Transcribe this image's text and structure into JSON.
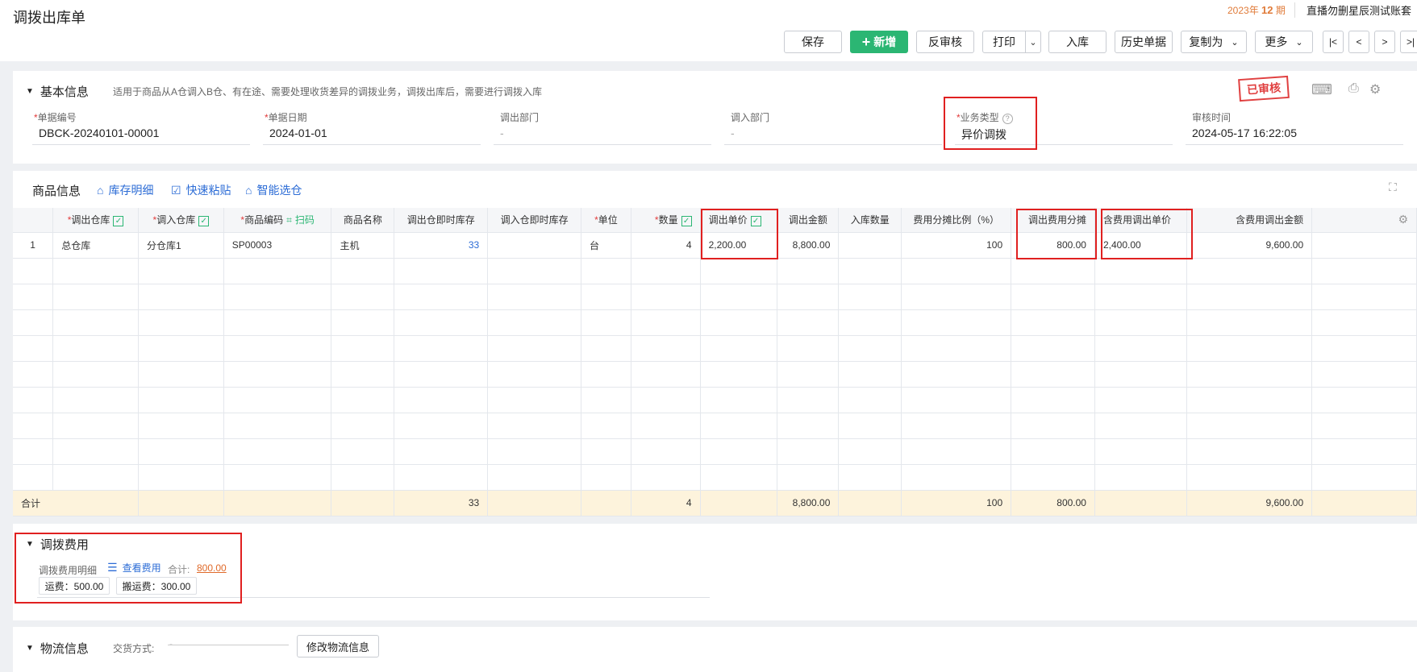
{
  "page": {
    "title": "调拨出库单"
  },
  "period": {
    "year": "2023年",
    "num": "12",
    "suffix": "期"
  },
  "account": {
    "name": "直播勿删星辰测试账套"
  },
  "toolbar": {
    "save": "保存",
    "add": "新增",
    "unaudit": "反审核",
    "print": "打印",
    "stock_in": "入库",
    "history": "历史单据",
    "copy_as": "复制为",
    "more": "更多"
  },
  "nav": {
    "first": "|<",
    "prev": "<",
    "next": ">",
    "last": ">|"
  },
  "basic": {
    "title": "基本信息",
    "desc": "适用于商品从A仓调入B仓、有在途、需要处理收货差异的调拨业务，调拨出库后，需要进行调拨入库",
    "stamp": "已审核",
    "fields": [
      {
        "label": "单据编号",
        "value": "DBCK-20240101-00001"
      },
      {
        "label": "单据日期",
        "value": "2024-01-01"
      },
      {
        "label": "调出部门",
        "value": "-"
      },
      {
        "label": "调入部门",
        "value": "-"
      },
      {
        "label": "业务类型",
        "value": "异价调拨"
      },
      {
        "label": "审核时间",
        "value": "2024-05-17 16:22:05"
      }
    ]
  },
  "goods": {
    "title": "商品信息",
    "links": [
      "库存明细",
      "快速粘贴",
      "智能选仓"
    ],
    "columns": {
      "out_wh": "调出仓库",
      "in_wh": "调入仓库",
      "code": "商品编码",
      "scan": "扫码",
      "name": "商品名称",
      "out_stock": "调出仓即时库存",
      "in_stock": "调入仓即时库存",
      "unit": "单位",
      "qty": "数量",
      "out_price": "调出单价",
      "out_amount": "调出金额",
      "in_qty": "入库数量",
      "ratio": "费用分摊比例（%）",
      "fee_share": "调出费用分摊",
      "price_with_fee": "含费用调出单价",
      "amount_with_fee": "含费用调出金额"
    },
    "rows": [
      {
        "no": "1",
        "out_wh": "总仓库",
        "in_wh": "分仓库1",
        "code": "SP00003",
        "name": "主机",
        "out_stock": "33",
        "in_stock": "",
        "unit": "台",
        "qty": "4",
        "out_price": "2,200.00",
        "out_amount": "8,800.00",
        "in_qty": "",
        "ratio": "100",
        "fee_share": "800.00",
        "price_with_fee": "2,400.00",
        "amount_with_fee": "9,600.00"
      }
    ],
    "total": {
      "label": "合计",
      "out_stock": "33",
      "qty": "4",
      "out_amount": "8,800.00",
      "ratio": "100",
      "fee_share": "800.00",
      "amount_with_fee": "9,600.00"
    }
  },
  "fees": {
    "title": "调拨费用",
    "detail_label": "调拨费用明细",
    "view_link": "查看费用",
    "total_label": "合计:",
    "total_value": "800.00",
    "chips": [
      "运费：500.00",
      "搬运费：300.00"
    ]
  },
  "logistics": {
    "title": "物流信息",
    "delivery_label": "交货方式:",
    "delivery_value": "-",
    "edit_button": "修改物流信息"
  },
  "colors": {
    "primary": "#2bb673",
    "link": "#2c6cd6",
    "highlight": "#e02020",
    "total_row": "#fdf3dc"
  }
}
